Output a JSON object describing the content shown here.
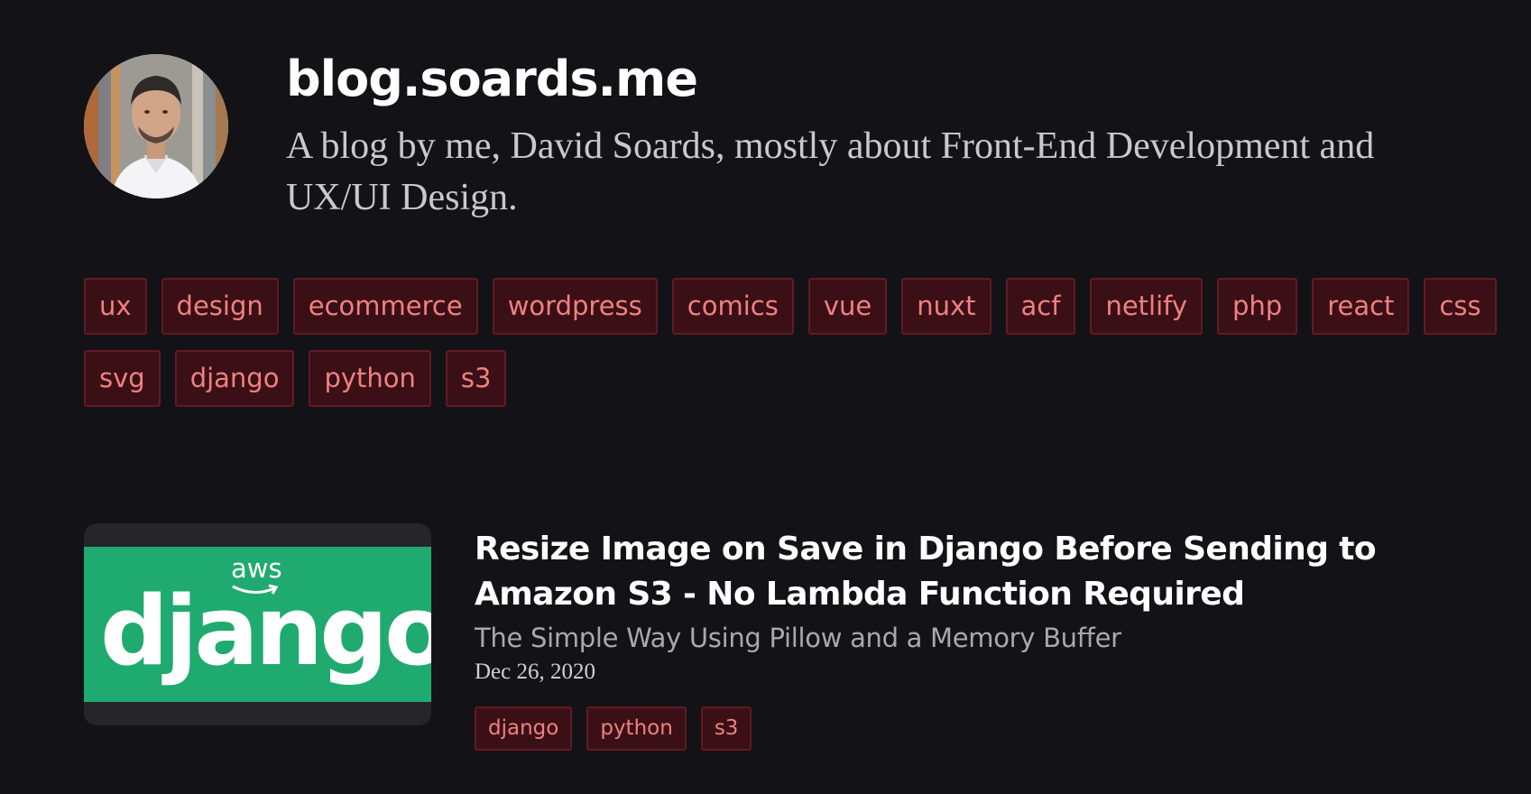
{
  "site": {
    "title": "blog.soards.me",
    "description": "A blog by me, David Soards, mostly about Front-End Development and UX/UI Design."
  },
  "tags": [
    {
      "label": "ux"
    },
    {
      "label": "design"
    },
    {
      "label": "ecommerce"
    },
    {
      "label": "wordpress"
    },
    {
      "label": "comics"
    },
    {
      "label": "vue"
    },
    {
      "label": "nuxt"
    },
    {
      "label": "acf"
    },
    {
      "label": "netlify"
    },
    {
      "label": "php"
    },
    {
      "label": "react"
    },
    {
      "label": "css"
    },
    {
      "label": "svg"
    },
    {
      "label": "django"
    },
    {
      "label": "python"
    },
    {
      "label": "s3"
    }
  ],
  "posts": [
    {
      "thumbnail": {
        "aws_text": "aws",
        "word": "django",
        "background_color": "#1faa70"
      },
      "title": "Resize Image on Save in Django Before Sending to Amazon S3 - No Lambda Function Required",
      "subtitle": "The Simple Way Using Pillow and a Memory Buffer",
      "date": "Dec 26, 2020",
      "tags": [
        {
          "label": "django"
        },
        {
          "label": "python"
        },
        {
          "label": "s3"
        }
      ]
    }
  ],
  "colors": {
    "background": "#131216",
    "tag_background": "#3b0f16",
    "tag_border": "#611a24",
    "tag_text": "#f08080"
  }
}
